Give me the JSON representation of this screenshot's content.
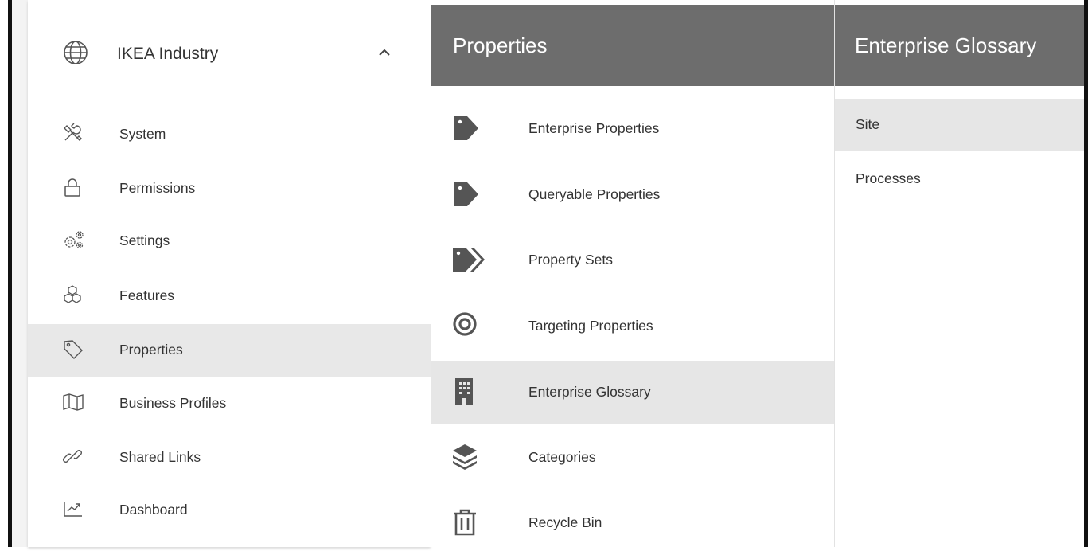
{
  "left_nav": {
    "org": {
      "label": "IKEA Industry",
      "icon": "globe-icon",
      "toggle_icon": "chevron-up-icon"
    },
    "items": [
      {
        "label": "System",
        "icon": "tools-icon"
      },
      {
        "label": "Permissions",
        "icon": "lock-icon"
      },
      {
        "label": "Settings",
        "icon": "gears-icon"
      },
      {
        "label": "Features",
        "icon": "cubes-icon"
      },
      {
        "label": "Properties",
        "icon": "tag-outline-icon",
        "active": true
      },
      {
        "label": "Business Profiles",
        "icon": "map-icon"
      },
      {
        "label": "Shared Links",
        "icon": "link-icon"
      },
      {
        "label": "Dashboard",
        "icon": "trend-chart-icon"
      }
    ]
  },
  "mid_panel": {
    "title": "Properties",
    "items": [
      {
        "label": "Enterprise Properties",
        "icon": "tag-icon"
      },
      {
        "label": "Queryable Properties",
        "icon": "tag-icon"
      },
      {
        "label": "Property Sets",
        "icon": "tags-icon"
      },
      {
        "label": "Targeting Properties",
        "icon": "target-icon"
      },
      {
        "label": "Enterprise Glossary",
        "icon": "building-icon",
        "active": true
      },
      {
        "label": "Categories",
        "icon": "layers-icon"
      },
      {
        "label": "Recycle Bin",
        "icon": "trash-icon"
      }
    ]
  },
  "right_panel": {
    "title": "Enterprise Glossary",
    "items": [
      {
        "label": "Site",
        "active": true
      },
      {
        "label": "Processes"
      }
    ]
  },
  "colors": {
    "header_bg": "#6d6d6d",
    "active_bg": "#e6e6e6",
    "icon": "#555555"
  }
}
